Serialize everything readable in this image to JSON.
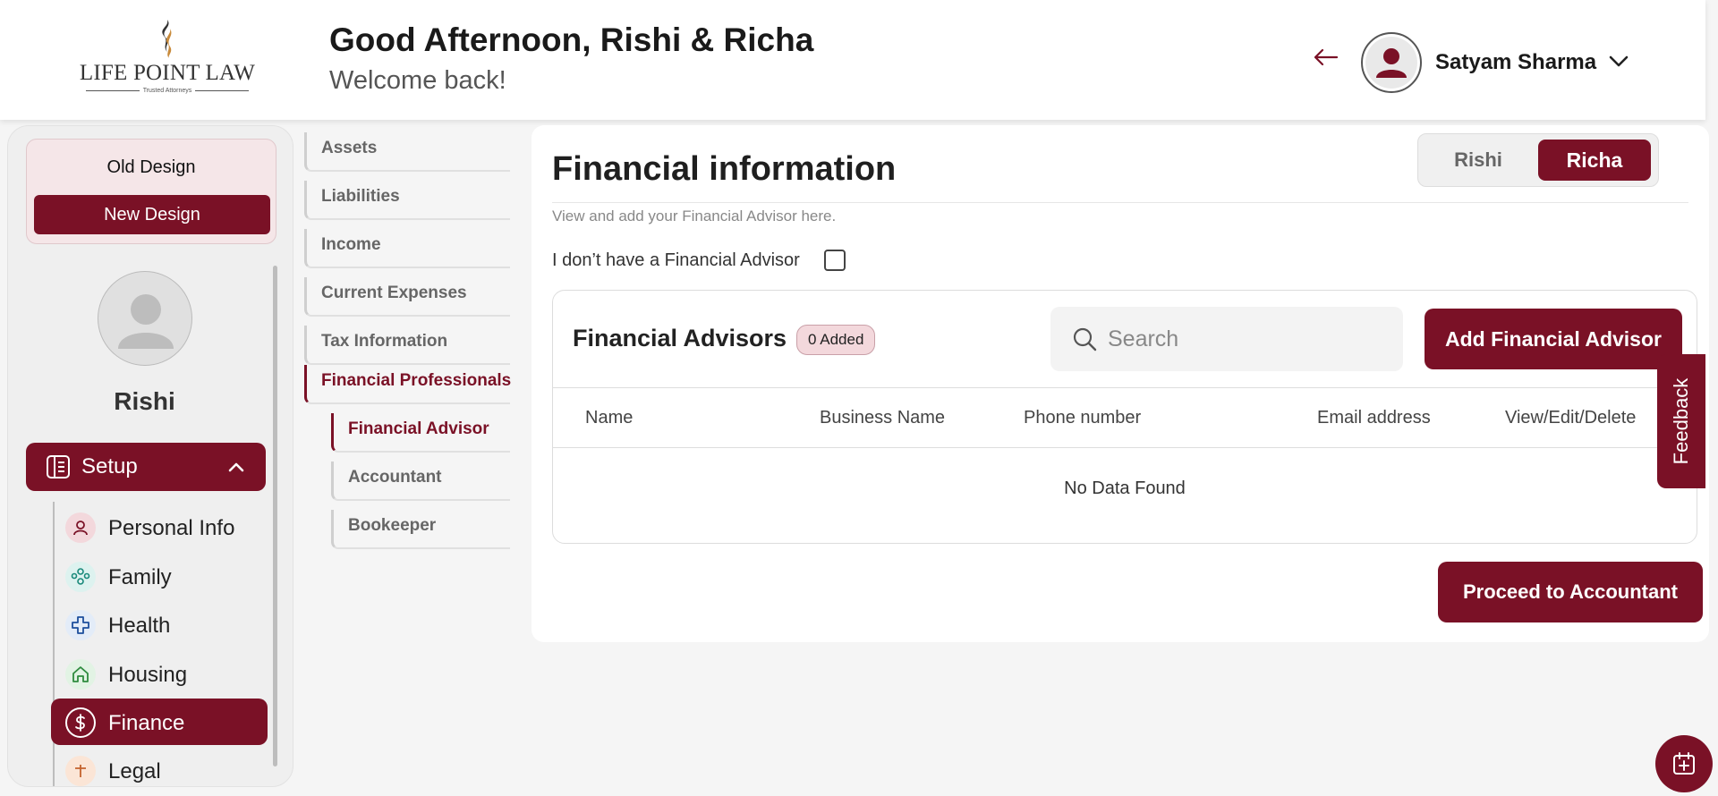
{
  "header": {
    "logo_name": "LIFE POINT LAW",
    "logo_tagline": "Trusted Attorneys",
    "greeting": "Good Afternoon, Rishi & Richa",
    "welcome": "Welcome back!",
    "user_name": "Satyam Sharma"
  },
  "sidebar": {
    "old_design_label": "Old Design",
    "new_design_label": "New Design",
    "profile_name": "Rishi",
    "setup_label": "Setup",
    "items": [
      {
        "label": "Personal Info",
        "icon": "person-icon"
      },
      {
        "label": "Family",
        "icon": "family-icon"
      },
      {
        "label": "Health",
        "icon": "health-cross-icon"
      },
      {
        "label": "Housing",
        "icon": "home-icon"
      },
      {
        "label": "Finance",
        "icon": "dollar-icon",
        "active": true
      },
      {
        "label": "Legal",
        "icon": "legal-icon"
      }
    ]
  },
  "subnav": {
    "items": [
      "Assets",
      "Liabilities",
      "Income",
      "Current Expenses",
      "Tax Information",
      "Financial Professionals"
    ],
    "sub_items": [
      "Financial Advisor",
      "Accountant",
      "Bookeeper"
    ]
  },
  "main": {
    "title": "Financial information",
    "toggle": {
      "left": "Rishi",
      "right": "Richa",
      "selected": "Richa"
    },
    "subtitle": "View and add your Financial Advisor here.",
    "no_advisor_label": "I don’t have a Financial Advisor",
    "card": {
      "title": "Financial Advisors",
      "badge": "0 Added",
      "search_placeholder": "Search",
      "add_button": "Add Financial Advisor",
      "columns": [
        "Name",
        "Business Name",
        "Phone number",
        "Email address",
        "View/Edit/Delete"
      ],
      "empty_text": "No Data Found"
    },
    "proceed_button": "Proceed to Accountant"
  },
  "feedback_label": "Feedback",
  "colors": {
    "accent": "#7a1126",
    "accent_light": "#f3d8dc"
  }
}
